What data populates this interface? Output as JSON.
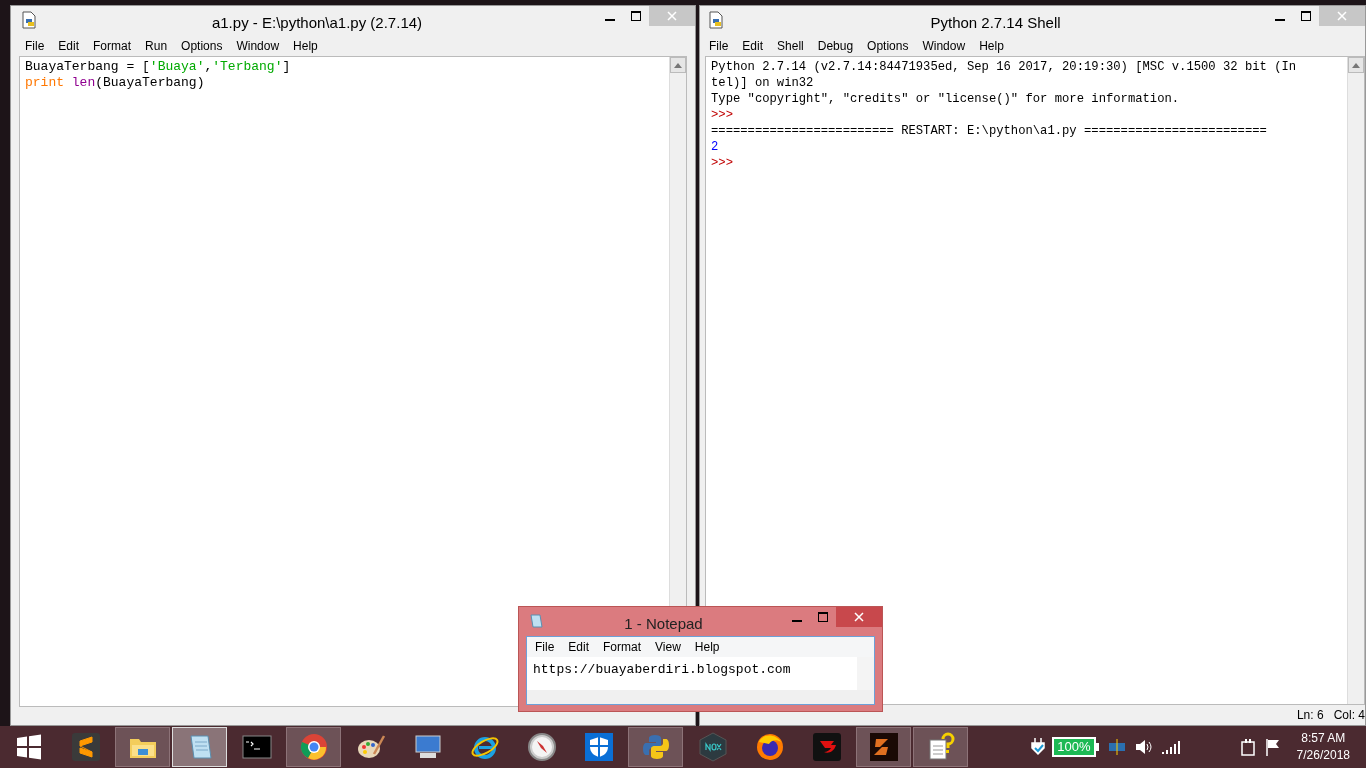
{
  "editor": {
    "title": "a1.py - E:\\python\\a1.py (2.7.14)",
    "menu": [
      "File",
      "Edit",
      "Format",
      "Run",
      "Options",
      "Window",
      "Help"
    ],
    "lines": [
      [
        {
          "kind": "plain",
          "text": "BuayaTerbang = ["
        },
        {
          "kind": "string",
          "text": "'Buaya'"
        },
        {
          "kind": "plain",
          "text": ","
        },
        {
          "kind": "string",
          "text": "'Terbang'"
        },
        {
          "kind": "plain",
          "text": "]"
        }
      ],
      [
        {
          "kind": "keyword",
          "text": "print"
        },
        {
          "kind": "builtin",
          "text": "len",
          "space_before": true
        },
        {
          "kind": "plain",
          "text": "(BuayaTerbang)"
        }
      ]
    ]
  },
  "shell": {
    "title": "Python 2.7.14 Shell",
    "menu": [
      "File",
      "Edit",
      "Shell",
      "Debug",
      "Options",
      "Window",
      "Help"
    ],
    "lines": [
      {
        "kind": "output",
        "text": "Python 2.7.14 (v2.7.14:84471935ed, Sep 16 2017, 20:19:30) [MSC v.1500 32 bit (In"
      },
      {
        "kind": "output",
        "text": "tel)] on win32"
      },
      {
        "kind": "output",
        "text": "Type \"copyright\", \"credits\" or \"license()\" for more information."
      },
      {
        "kind": "prompt",
        "text": ">>>"
      },
      {
        "kind": "output",
        "text": "========================= RESTART: E:\\python\\a1.py ========================="
      },
      {
        "kind": "stdout",
        "text": "2"
      },
      {
        "kind": "prompt",
        "text": ">>>"
      }
    ],
    "status": [
      "Ln: 6",
      "Col: 4"
    ]
  },
  "notepad": {
    "title": "1 - Notepad",
    "menu": [
      "File",
      "Edit",
      "Format",
      "View",
      "Help"
    ],
    "content": "https://buayaberdiri.blogspot.com"
  },
  "taskbar": {
    "apps": [
      {
        "kind": "windows",
        "running": false,
        "selected": false
      },
      {
        "kind": "sublime",
        "running": false,
        "selected": false
      },
      {
        "kind": "explorer",
        "running": true,
        "selected": false
      },
      {
        "kind": "notepad",
        "running": true,
        "selected": true
      },
      {
        "kind": "cmd",
        "running": false,
        "selected": false
      },
      {
        "kind": "chrome",
        "running": true,
        "selected": false
      },
      {
        "kind": "paint",
        "running": false,
        "selected": false
      },
      {
        "kind": "remote",
        "running": false,
        "selected": false
      },
      {
        "kind": "ie",
        "running": false,
        "selected": false
      },
      {
        "kind": "compass",
        "running": false,
        "selected": false
      },
      {
        "kind": "shield",
        "running": false,
        "selected": false
      },
      {
        "kind": "python",
        "running": true,
        "selected": false
      },
      {
        "kind": "nox",
        "running": false,
        "selected": false
      },
      {
        "kind": "firefox",
        "running": false,
        "selected": false
      },
      {
        "kind": "garena",
        "running": false,
        "selected": false
      },
      {
        "kind": "game",
        "running": true,
        "selected": false
      },
      {
        "kind": "help",
        "running": true,
        "selected": false
      }
    ],
    "battery": "100%",
    "time": "8:57 AM",
    "date": "7/26/2018"
  }
}
